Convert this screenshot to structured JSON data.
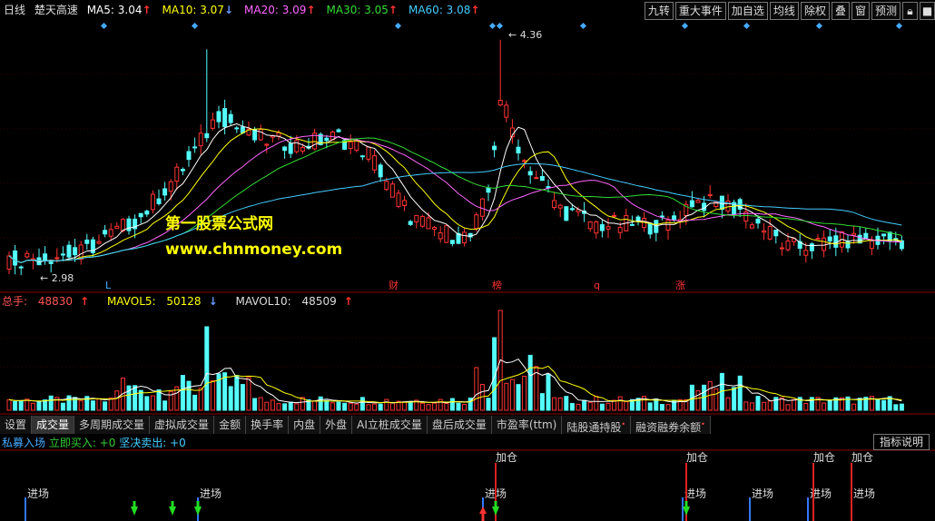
{
  "header": {
    "period": "日线",
    "stock_name": "楚天高速",
    "ma": [
      {
        "label": "MA5:",
        "value": "3.04",
        "arrow": "↑",
        "color": "#ffffff"
      },
      {
        "label": "MA10:",
        "value": "3.07",
        "arrow": "↓",
        "color": "#ffff00"
      },
      {
        "label": "MA20:",
        "value": "3.09",
        "arrow": "↑",
        "color": "#ff66ff"
      },
      {
        "label": "MA30:",
        "value": "3.05",
        "arrow": "↑",
        "color": "#33dd33"
      },
      {
        "label": "MA60:",
        "value": "3.08",
        "arrow": "↑",
        "color": "#44ccff"
      }
    ]
  },
  "toolbar": {
    "jiuzhuan": "九转",
    "major_events": "重大事件",
    "add_watch": "加自选",
    "ma_line": "均线",
    "ex_rights": "除权",
    "overlay": "叠",
    "window": "窗",
    "forecast": "预测",
    "lock_icon": "lock-icon",
    "more_icon": "more-icon"
  },
  "price_chart": {
    "high_label": "4.36",
    "low_label": "2.98",
    "event_markers": [
      "L",
      "财",
      "榜",
      "q",
      "涨"
    ]
  },
  "watermark": {
    "line1": "第一股票公式网",
    "line2": "www.chnmoney.com"
  },
  "volume": {
    "total_label": "总手:",
    "total_value": "48830",
    "total_arrow": "↑",
    "mavol5_label": "MAVOL5:",
    "mavol5_value": "50128",
    "mavol5_arrow": "↓",
    "mavol10_label": "MAVOL10:",
    "mavol10_value": "48509",
    "mavol10_arrow": "↑"
  },
  "tabs": [
    "设置",
    "成交量",
    "多周期成交量",
    "虚拟成交量",
    "金额",
    "换手率",
    "内盘",
    "外盘",
    "AI立桩成交量",
    "盘后成交量",
    "市盈率(ttm)",
    "陆股通持股",
    "融资融券余额"
  ],
  "signal": {
    "title": "私募入场",
    "buy_label": "立即买入:",
    "buy_value": "+0",
    "sell_label": "坚决卖出:",
    "sell_value": "+0",
    "explain": "指标说明",
    "enter_label": "进场",
    "add_label": "加仓"
  },
  "colors": {
    "up": "#ff3333",
    "down": "#54fcfc",
    "accent": "#ffff00"
  }
}
